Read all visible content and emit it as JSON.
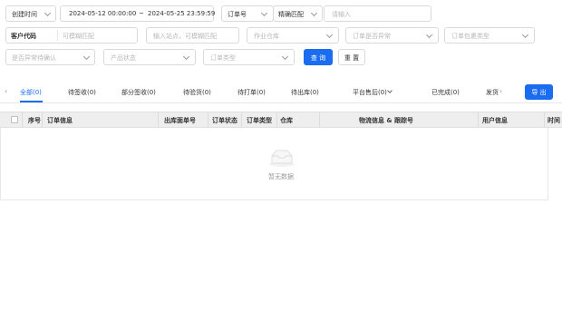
{
  "filters": {
    "row1": {
      "time_type": "创建时间",
      "start_date": "2024-05-12 00:00:00",
      "range_sep": "~",
      "end_date": "2024-05-25 23:59:59",
      "order_field": "订单号",
      "match_mode": "精确匹配",
      "order_placeholder": "请输入"
    },
    "row2": {
      "customer_code_label": "客户代码",
      "customer_code_placeholder": "可模糊匹配",
      "site_placeholder": "输入站点，可模糊匹配",
      "warehouse_placeholder": "作业仓库",
      "exception_placeholder": "订单是否异常",
      "package_type_placeholder": "订单包裹类型"
    },
    "row3": {
      "exception_confirm_placeholder": "是否异常待确认",
      "product_status_placeholder": "产品状态",
      "order_type_placeholder": "订单类型",
      "search_label": "查 询",
      "reset_label": "重 置"
    }
  },
  "tabs": [
    {
      "label": "全部(0)"
    },
    {
      "label": "待签收(0)"
    },
    {
      "label": "部分签收(0)"
    },
    {
      "label": "待验货(0)"
    },
    {
      "label": "待打单(0)"
    },
    {
      "label": "待出库(0)"
    },
    {
      "label": "平台售后(0)"
    },
    {
      "label": "已完成(0)"
    },
    {
      "label": "发货"
    }
  ],
  "export_label": "导 出",
  "table": {
    "headers": [
      "序号",
      "订单信息",
      "出库面单号",
      "订单状态",
      "订单类型",
      "仓库",
      "物流信息 & 跟踪号",
      "用户信息",
      "时间"
    ],
    "empty_text": "暂无数据"
  },
  "colors": {
    "primary": "#1a6cf0",
    "border": "#d9d9d9",
    "header_bg": "#eeeeee"
  }
}
